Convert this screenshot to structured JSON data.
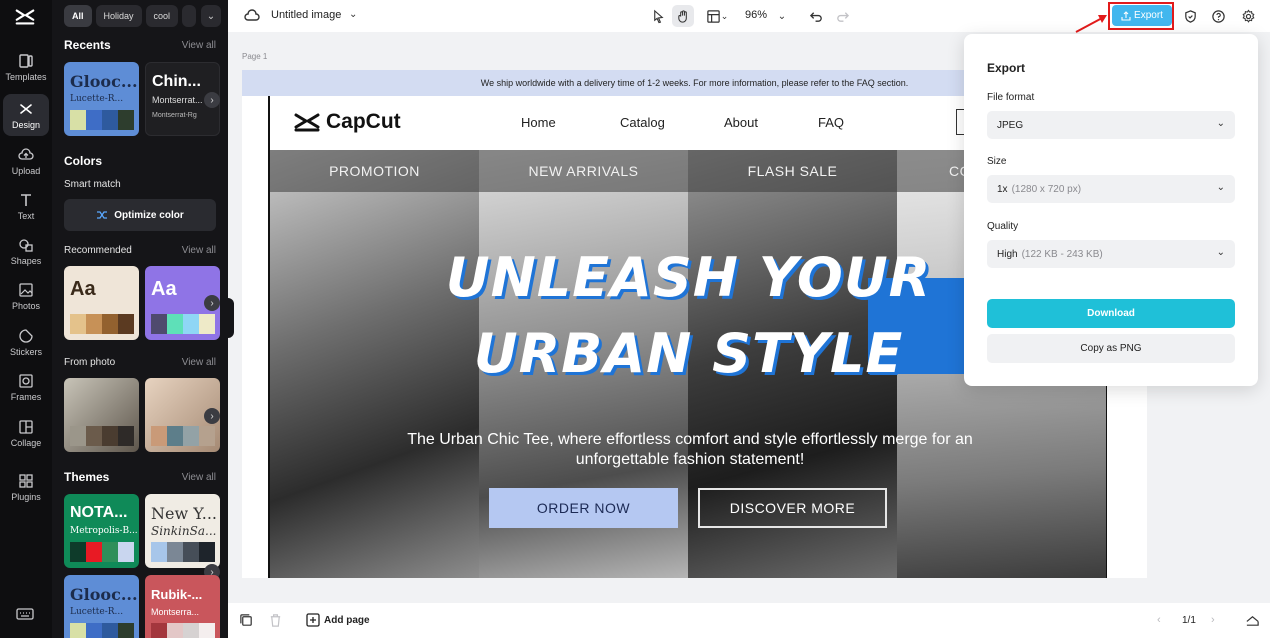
{
  "rail": {
    "items": [
      {
        "label": "Templates",
        "icon": "templates-icon"
      },
      {
        "label": "Design",
        "icon": "design-icon"
      },
      {
        "label": "Upload",
        "icon": "upload-icon"
      },
      {
        "label": "Text",
        "icon": "text-icon"
      },
      {
        "label": "Shapes",
        "icon": "shapes-icon"
      },
      {
        "label": "Photos",
        "icon": "photos-icon"
      },
      {
        "label": "Stickers",
        "icon": "stickers-icon"
      },
      {
        "label": "Frames",
        "icon": "frames-icon"
      },
      {
        "label": "Collage",
        "icon": "collage-icon"
      },
      {
        "label": "Plugins",
        "icon": "plugins-icon"
      }
    ]
  },
  "panel": {
    "chips": [
      "All",
      "Holiday",
      "cool"
    ],
    "recents": {
      "title": "Recents",
      "view_all": "View all",
      "cards": [
        {
          "t1": "Glooc...",
          "t2": "Lucette-R...",
          "colors": [
            "#d8e0a6",
            "#3e6dc6",
            "#2e5a9e",
            "#2d3d2d"
          ],
          "bg": "#5e8dd6"
        },
        {
          "t1": "Chin...",
          "t2": "Montserrat...",
          "t3": "Montserrat-Rg",
          "bg": "#1f1f22"
        }
      ]
    },
    "colors": {
      "title": "Colors",
      "smart_match": "Smart match",
      "optimize_label": "Optimize color",
      "recommended": "Recommended",
      "view_all_1": "View all",
      "rec_cards": [
        {
          "text": "Aa",
          "bg": "#efe5d8",
          "fg": "#3a2a1a",
          "colors": [
            "#e4c28b",
            "#c79157",
            "#93612f",
            "#5b3a21"
          ]
        },
        {
          "text": "Aa",
          "bg": "#8f74e6",
          "fg": "#ffffff",
          "colors": [
            "#4f4a6e",
            "#5ee0b8",
            "#8fd6f5",
            "#eeeac8"
          ]
        }
      ],
      "from_photo": "From photo",
      "view_all_2": "View all",
      "photo_colors_1": [
        "#9b968a",
        "#6b5b4b",
        "#4a3c30",
        "#2e2a28"
      ],
      "photo_colors_2": [
        "#c99a78",
        "#5d7e8a",
        "#93a2a6",
        "#b5a18e"
      ]
    },
    "themes": {
      "title": "Themes",
      "view_all": "View all",
      "cards": [
        {
          "t1": "NOTA...",
          "t2": "Metropolis-B...",
          "bg": "#0f8a58",
          "fg": "#ffffff",
          "colors": [
            "#0e3b2a",
            "#e81a24",
            "#2f8f5a",
            "#c9d6ef"
          ]
        },
        {
          "t1": "New Y...",
          "t2": "SinkinSa...",
          "bg": "#f0ece4",
          "fg": "#333333",
          "colors": [
            "#a7c6ea",
            "#7b8795",
            "#464e58",
            "#1e242b"
          ]
        },
        {
          "t1": "Glooc...",
          "t2": "Lucette-R...",
          "bg": "#5e8dd6",
          "fg": "#1c2c4c",
          "colors": [
            "#d8e0a6",
            "#3e6dc6",
            "#2e5a9e",
            "#2d3d2d"
          ]
        },
        {
          "t1": "Rubik-...",
          "t2": "Montserra...",
          "bg": "#c9565c",
          "fg": "#ffffff",
          "colors": [
            "#a3363d",
            "#e3c7c7",
            "#d6d2d2",
            "#f4eeee"
          ]
        }
      ]
    }
  },
  "topbar": {
    "doc_title": "Untitled image",
    "zoom": "96%",
    "export_label": "Export"
  },
  "page_label": "Page 1",
  "design": {
    "notice": "We ship worldwide with a delivery time of 1-2 weeks. For more information, please refer to the FAQ section.",
    "brand": "CapCut",
    "nav": [
      "Home",
      "Catalog",
      "About",
      "FAQ"
    ],
    "panels": [
      "PROMOTION",
      "NEW ARRIVALS",
      "FLASH SALE",
      "CO"
    ],
    "headline_1": "UNLEASH YOUR",
    "headline_2": "URBAN STYLE",
    "subline": "The Urban Chic Tee, where effortless comfort and style effortlessly merge for an unforgettable fashion statement!",
    "cta_primary": "ORDER NOW",
    "cta_secondary": "DISCOVER MORE",
    "accent": "#1f74d6"
  },
  "export_panel": {
    "title": "Export",
    "file_format_label": "File format",
    "file_format_value": "JPEG",
    "size_label": "Size",
    "size_value": "1x",
    "size_detail": "(1280 x 720 px)",
    "quality_label": "Quality",
    "quality_value": "High",
    "quality_detail": "(122 KB - 243 KB)",
    "download_label": "Download",
    "copy_label": "Copy as PNG"
  },
  "bottombar": {
    "add_page": "Add page",
    "pager": "1/1"
  }
}
